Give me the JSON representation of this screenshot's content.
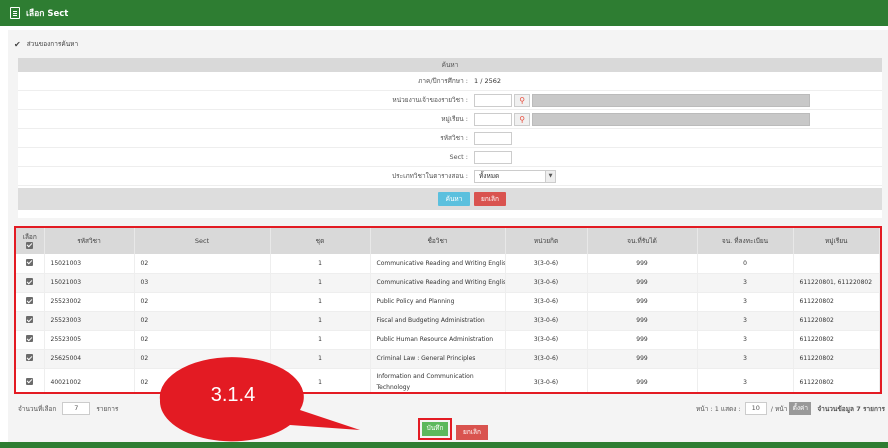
{
  "colors": {
    "header_green": "#2e7d32",
    "highlight_red": "#e31b23",
    "search_btn": "#5bc0de",
    "cancel_btn": "#d9534f",
    "save_btn": "#5cb85c"
  },
  "window": {
    "title": "เลือก Sect"
  },
  "search_section": {
    "toggle_label": "ส่วนของการค้นหา",
    "panel_title": "ค้นหา",
    "term_label": "ภาค/ปีการศึกษา :",
    "term_value": "1 / 2562",
    "course_owner_label": "หน่วยงานเจ้าของรายวิชา :",
    "student_group_label": "หมู่เรียน :",
    "course_code_label": "รหัสวิชา :",
    "sect_label": "Sect :",
    "schedule_type_label": "ประเภทวิชาในตารางสอน :",
    "schedule_type_value": "ทั้งหมด",
    "search_button": "ค้นหา",
    "cancel_button": "ยกเลิก"
  },
  "table": {
    "headers": [
      "เลือก",
      "รหัสวิชา",
      "Sect",
      "ชุด",
      "ชื่อวิชา",
      "หน่วยกิต",
      "จน.ที่รับได้",
      "จน. ที่ลงทะเบียน",
      "หมู่เรียน"
    ],
    "rows": [
      {
        "code": "15021003",
        "sect": "02",
        "set": "1",
        "name": "Communicative Reading and Writing English",
        "credit": "3(3-0-6)",
        "capacity": "999",
        "registered": "0",
        "group": ""
      },
      {
        "code": "15021003",
        "sect": "03",
        "set": "1",
        "name": "Communicative Reading and Writing English",
        "credit": "3(3-0-6)",
        "capacity": "999",
        "registered": "3",
        "group": "611220801, 611220802"
      },
      {
        "code": "25523002",
        "sect": "02",
        "set": "1",
        "name": "Public Policy and Planning",
        "credit": "3(3-0-6)",
        "capacity": "999",
        "registered": "3",
        "group": "611220802"
      },
      {
        "code": "25523003",
        "sect": "02",
        "set": "1",
        "name": "Fiscal and Budgeting Administration",
        "credit": "3(3-0-6)",
        "capacity": "999",
        "registered": "3",
        "group": "611220802"
      },
      {
        "code": "25523005",
        "sect": "02",
        "set": "1",
        "name": "Public Human Resource Administration",
        "credit": "3(3-0-6)",
        "capacity": "999",
        "registered": "3",
        "group": "611220802"
      },
      {
        "code": "25625004",
        "sect": "02",
        "set": "1",
        "name": "Criminal Law : General Principles",
        "credit": "3(3-0-6)",
        "capacity": "999",
        "registered": "3",
        "group": "611220802"
      },
      {
        "code": "40021002",
        "sect": "02",
        "set": "1",
        "name": "Information and Communication Technology",
        "credit": "3(3-0-6)",
        "capacity": "999",
        "registered": "3",
        "group": "611220802"
      }
    ]
  },
  "footer": {
    "selected_label": "จำนวนที่เลือก",
    "selected_count": "7",
    "selected_unit": "รายการ",
    "page_label": "หน้า : 1 แสดง :",
    "per_page": "10",
    "per_page_unit": "/ หน้า",
    "apply_button": "ตั้งค่า",
    "total_label": "จำนวนข้อมูล 7 รายการ",
    "save_button": "บันทึก",
    "cancel_button": "ยกเลิก"
  },
  "annotation": {
    "label": "3.1.4"
  }
}
